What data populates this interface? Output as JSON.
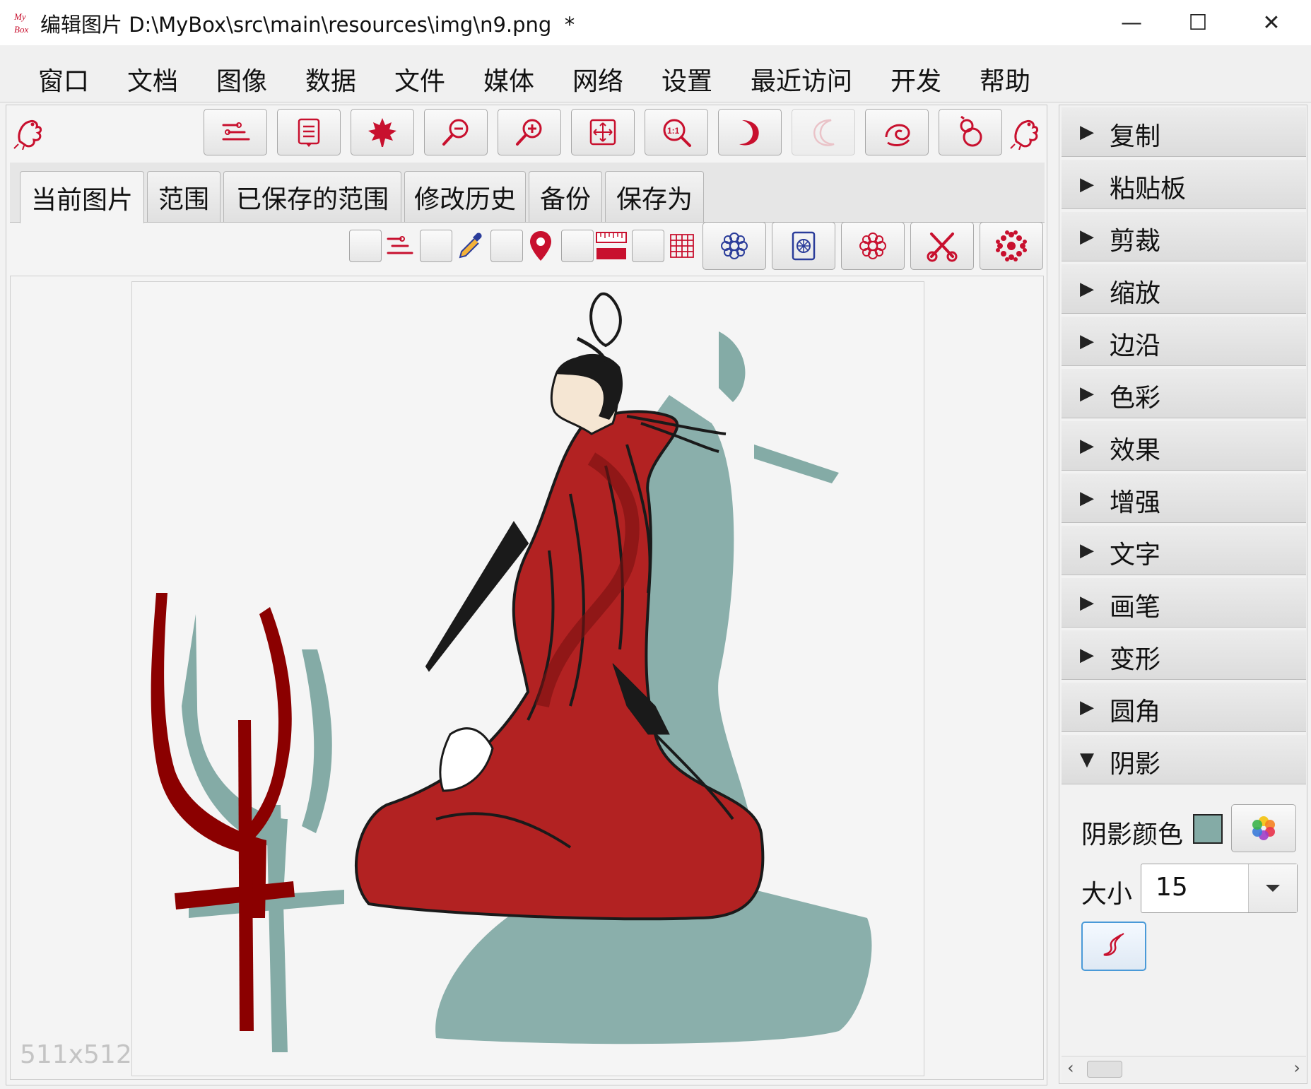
{
  "window": {
    "title": "编辑图片 D:\\MyBox\\src\\main\\resources\\img\\n9.png  *",
    "minimize_glyph": "—",
    "maximize_glyph": "☐",
    "close_glyph": "✕"
  },
  "menu": [
    "窗口",
    "文档",
    "图像",
    "数据",
    "文件",
    "媒体",
    "网络",
    "设置",
    "最近访问",
    "开发",
    "帮助"
  ],
  "toolbar_icons": [
    "options-icon",
    "list-icon",
    "maple-leaf-icon",
    "zoom-out-icon",
    "zoom-in-icon",
    "fit-window-icon",
    "actual-size-icon",
    "rotate-right-icon",
    "rotate-left-icon",
    "spiral-icon",
    "gourd-icon"
  ],
  "tabs": [
    "当前图片",
    "范围",
    "已保存的范围",
    "修改历史",
    "备份",
    "保存为"
  ],
  "active_tab": "当前图片",
  "image": {
    "dimensions_label": "511x512",
    "shadow_color": "#84aba6",
    "robe_color": "#b22222"
  },
  "operations": [
    "复制",
    "粘贴板",
    "剪裁",
    "缩放",
    "边沿",
    "色彩",
    "效果",
    "增强",
    "文字",
    "画笔",
    "变形",
    "圆角",
    "阴影"
  ],
  "expanded_operation": "阴影",
  "shadow_panel": {
    "color_label": "阴影颜色",
    "color_value": "#84aba6",
    "size_label": "大小",
    "size_value": "15"
  },
  "colors": {
    "accent": "#c8102e",
    "icon_blue": "#2a3c9a"
  }
}
